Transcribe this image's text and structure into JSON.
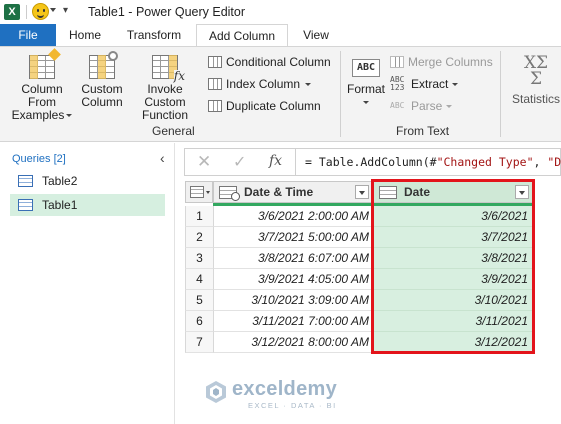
{
  "window": {
    "title": "Table1 - Power Query Editor"
  },
  "tabs": [
    "File",
    "Home",
    "Transform",
    "Add Column",
    "View"
  ],
  "ribbon": {
    "column_from_examples": {
      "line1": "Column From",
      "line2": "Examples"
    },
    "custom_column": {
      "line1": "Custom",
      "line2": "Column"
    },
    "invoke_custom_function": {
      "line1": "Invoke Custom",
      "line2": "Function"
    },
    "conditional_column": "Conditional Column",
    "index_column": "Index Column",
    "duplicate_column": "Duplicate Column",
    "general_label": "General",
    "format": "Format",
    "abc_icon": "ABC",
    "abc123_icon": "ABC\n123",
    "merge_columns": "Merge Columns",
    "extract": "Extract",
    "parse": "Parse",
    "from_text_label": "From Text",
    "statistics": "Statistics",
    "sigma_icon": "XΣ\nΣ"
  },
  "queries": {
    "header": "Queries [2]",
    "items": [
      "Table2",
      "Table1"
    ],
    "selected": "Table1"
  },
  "formula_bar": {
    "fx": "fx",
    "prefix": "= Table.AddColumn(#",
    "str1": "\"Changed Type\"",
    "mid": ", ",
    "str2": "\"Dat"
  },
  "grid": {
    "columns": [
      "Date & Time",
      "Date"
    ],
    "rows": [
      {
        "n": "1",
        "dt": "3/6/2021 2:00:00 AM",
        "date": "3/6/2021"
      },
      {
        "n": "2",
        "dt": "3/7/2021 5:00:00 AM",
        "date": "3/7/2021"
      },
      {
        "n": "3",
        "dt": "3/8/2021 6:07:00 AM",
        "date": "3/8/2021"
      },
      {
        "n": "4",
        "dt": "3/9/2021 4:05:00 AM",
        "date": "3/9/2021"
      },
      {
        "n": "5",
        "dt": "3/10/2021 3:09:00 AM",
        "date": "3/10/2021"
      },
      {
        "n": "6",
        "dt": "3/11/2021 7:00:00 AM",
        "date": "3/11/2021"
      },
      {
        "n": "7",
        "dt": "3/12/2021 8:00:00 AM",
        "date": "3/12/2021"
      }
    ]
  },
  "watermark": {
    "name": "exceldemy",
    "tagline": "EXCEL · DATA · BI"
  },
  "colors": {
    "file_tab": "#1f70c1",
    "selected_query": "#d6efe0",
    "date_column": "#d8efe0",
    "highlight_box": "#e3141b"
  }
}
